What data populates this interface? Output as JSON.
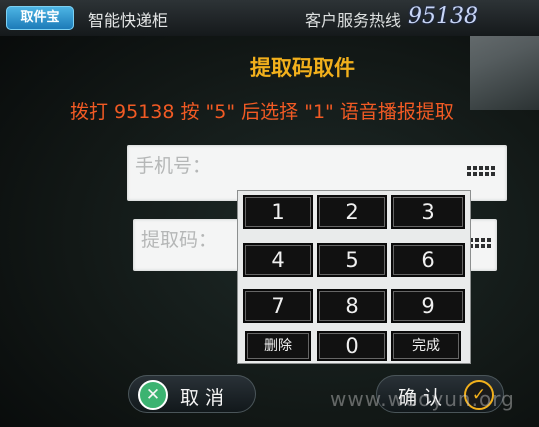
{
  "header": {
    "logo_text": "取件宝",
    "subtitle": "智能快递柜",
    "hotline_label": "客户服务热线",
    "hotline_number": "95138"
  },
  "main": {
    "title": "提取码取件",
    "instruction": "拨打 95138 按 \"5\" 后选择 \"1\" 语音播报提取"
  },
  "fields": {
    "phone_placeholder": "手机号：",
    "code_placeholder": "提取码："
  },
  "keypad": {
    "keys": [
      "1",
      "2",
      "3",
      "4",
      "5",
      "6",
      "7",
      "8",
      "9",
      "删除",
      "0",
      "完成"
    ]
  },
  "actions": {
    "cancel_label": "取 消",
    "confirm_label": "确 认"
  },
  "watermark": "www.wooyun.org",
  "colors": {
    "title": "#f2b01c",
    "instruction": "#f15a24",
    "cancel_icon": "#3cb371",
    "confirm_icon": "#f2b01c"
  }
}
